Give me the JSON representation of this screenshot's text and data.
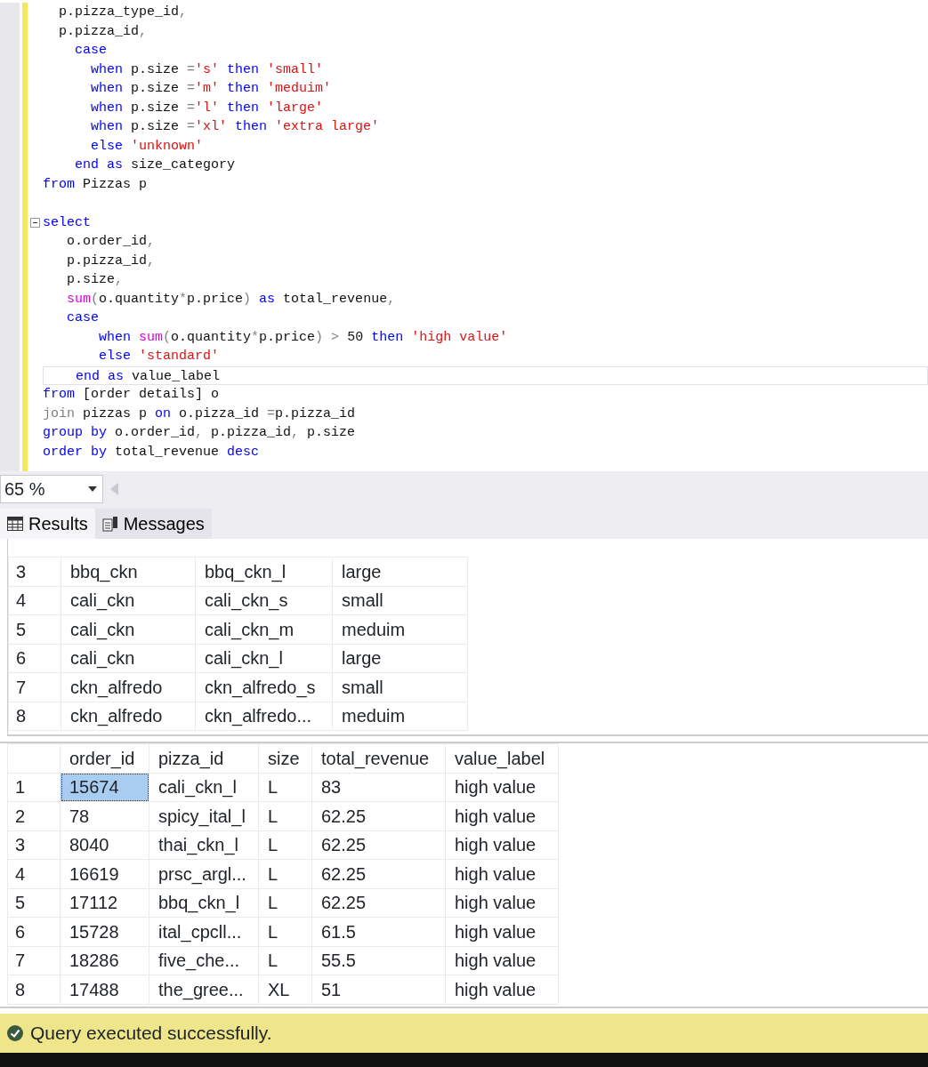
{
  "editor": {
    "lines": [
      {
        "current": false,
        "fold": false,
        "tokens": [
          {
            "kind": "id",
            "text": "  p.pizza_type_id"
          },
          {
            "kind": "op",
            "text": ","
          }
        ]
      },
      {
        "current": false,
        "fold": false,
        "tokens": [
          {
            "kind": "id",
            "text": "  p.pizza_id"
          },
          {
            "kind": "op",
            "text": ","
          }
        ]
      },
      {
        "current": false,
        "fold": false,
        "tokens": [
          {
            "kind": "kw",
            "text": "    case"
          }
        ]
      },
      {
        "current": false,
        "fold": false,
        "tokens": [
          {
            "kind": "kw",
            "text": "      when"
          },
          {
            "kind": "id",
            "text": " p.size "
          },
          {
            "kind": "op",
            "text": "="
          },
          {
            "kind": "str",
            "text": "'s'"
          },
          {
            "kind": "kw",
            "text": " then "
          },
          {
            "kind": "str",
            "text": "'small'"
          }
        ]
      },
      {
        "current": false,
        "fold": false,
        "tokens": [
          {
            "kind": "kw",
            "text": "      when"
          },
          {
            "kind": "id",
            "text": " p.size "
          },
          {
            "kind": "op",
            "text": "="
          },
          {
            "kind": "str",
            "text": "'m'"
          },
          {
            "kind": "kw",
            "text": " then "
          },
          {
            "kind": "str",
            "text": "'meduim'"
          }
        ]
      },
      {
        "current": false,
        "fold": false,
        "tokens": [
          {
            "kind": "kw",
            "text": "      when"
          },
          {
            "kind": "id",
            "text": " p.size "
          },
          {
            "kind": "op",
            "text": "="
          },
          {
            "kind": "str",
            "text": "'l'"
          },
          {
            "kind": "kw",
            "text": " then "
          },
          {
            "kind": "str",
            "text": "'large'"
          }
        ]
      },
      {
        "current": false,
        "fold": false,
        "tokens": [
          {
            "kind": "kw",
            "text": "      when"
          },
          {
            "kind": "id",
            "text": " p.size "
          },
          {
            "kind": "op",
            "text": "="
          },
          {
            "kind": "str",
            "text": "'xl'"
          },
          {
            "kind": "kw",
            "text": " then "
          },
          {
            "kind": "str",
            "text": "'extra large'"
          }
        ]
      },
      {
        "current": false,
        "fold": false,
        "tokens": [
          {
            "kind": "kw",
            "text": "      else "
          },
          {
            "kind": "str",
            "text": "'unknown'"
          }
        ]
      },
      {
        "current": false,
        "fold": false,
        "tokens": [
          {
            "kind": "kw",
            "text": "    end as"
          },
          {
            "kind": "id",
            "text": " size_category"
          }
        ]
      },
      {
        "current": false,
        "fold": false,
        "tokens": [
          {
            "kind": "kw",
            "text": "from"
          },
          {
            "kind": "id",
            "text": " Pizzas p"
          }
        ]
      },
      {
        "current": false,
        "fold": false
      },
      {
        "current": false,
        "fold": true,
        "tokens": [
          {
            "kind": "kw",
            "text": "select"
          }
        ]
      },
      {
        "current": false,
        "fold": false,
        "tokens": [
          {
            "kind": "id",
            "text": "   o.order_id"
          },
          {
            "kind": "op",
            "text": ","
          }
        ]
      },
      {
        "current": false,
        "fold": false,
        "tokens": [
          {
            "kind": "id",
            "text": "   p.pizza_id"
          },
          {
            "kind": "op",
            "text": ","
          }
        ]
      },
      {
        "current": false,
        "fold": false,
        "tokens": [
          {
            "kind": "id",
            "text": "   p.size"
          },
          {
            "kind": "op",
            "text": ","
          }
        ]
      },
      {
        "current": false,
        "fold": false,
        "tokens": [
          {
            "kind": "fn",
            "text": "   sum"
          },
          {
            "kind": "op",
            "text": "("
          },
          {
            "kind": "id",
            "text": "o.quantity"
          },
          {
            "kind": "op",
            "text": "*"
          },
          {
            "kind": "id",
            "text": "p.price"
          },
          {
            "kind": "op",
            "text": ")"
          },
          {
            "kind": "kw",
            "text": " as"
          },
          {
            "kind": "id",
            "text": " total_revenue"
          },
          {
            "kind": "op",
            "text": ","
          }
        ]
      },
      {
        "current": false,
        "fold": false,
        "tokens": [
          {
            "kind": "kw",
            "text": "   case"
          }
        ]
      },
      {
        "current": false,
        "fold": false,
        "tokens": [
          {
            "kind": "kw",
            "text": "       when "
          },
          {
            "kind": "fn",
            "text": "sum"
          },
          {
            "kind": "op",
            "text": "("
          },
          {
            "kind": "id",
            "text": "o.quantity"
          },
          {
            "kind": "op",
            "text": "*"
          },
          {
            "kind": "id",
            "text": "p.price"
          },
          {
            "kind": "op",
            "text": ") >"
          },
          {
            "kind": "id",
            "text": " 50 "
          },
          {
            "kind": "kw",
            "text": "then "
          },
          {
            "kind": "str",
            "text": "'high value'"
          }
        ]
      },
      {
        "current": false,
        "fold": false,
        "tokens": [
          {
            "kind": "kw",
            "text": "       else "
          },
          {
            "kind": "str",
            "text": "'standard'"
          }
        ]
      },
      {
        "current": true,
        "fold": false,
        "tokens": [
          {
            "kind": "kw",
            "text": "    end as"
          },
          {
            "kind": "id",
            "text": " value_label"
          }
        ]
      },
      {
        "current": false,
        "fold": false,
        "tokens": [
          {
            "kind": "kw",
            "text": "from"
          },
          {
            "kind": "id",
            "text": " [order details] o"
          }
        ]
      },
      {
        "current": false,
        "fold": false,
        "tokens": [
          {
            "kind": "op",
            "text": "join"
          },
          {
            "kind": "id",
            "text": " pizzas p "
          },
          {
            "kind": "kw",
            "text": "on"
          },
          {
            "kind": "id",
            "text": " o.pizza_id "
          },
          {
            "kind": "op",
            "text": "="
          },
          {
            "kind": "id",
            "text": "p.pizza_id"
          }
        ]
      },
      {
        "current": false,
        "fold": false,
        "tokens": [
          {
            "kind": "kw",
            "text": "group by"
          },
          {
            "kind": "id",
            "text": " o.order_id"
          },
          {
            "kind": "op",
            "text": ","
          },
          {
            "kind": "id",
            "text": " p.pizza_id"
          },
          {
            "kind": "op",
            "text": ","
          },
          {
            "kind": "id",
            "text": " p.size"
          }
        ]
      },
      {
        "current": false,
        "fold": false,
        "tokens": [
          {
            "kind": "kw",
            "text": "order by"
          },
          {
            "kind": "id",
            "text": " total_revenue "
          },
          {
            "kind": "kw",
            "text": "desc"
          }
        ]
      }
    ]
  },
  "zoom": {
    "value": "65 %"
  },
  "tabs": [
    {
      "label": "Results",
      "selected": true
    },
    {
      "label": "Messages",
      "selected": false
    }
  ],
  "grids": [
    {
      "rows": [
        {
          "number": "3",
          "selected": false,
          "cells": [
            "bbq_ckn",
            "bbq_ckn_l",
            "large"
          ]
        },
        {
          "number": "4",
          "selected": false,
          "cells": [
            "cali_ckn",
            "cali_ckn_s",
            "small"
          ]
        },
        {
          "number": "5",
          "selected": false,
          "cells": [
            "cali_ckn",
            "cali_ckn_m",
            "meduim"
          ]
        },
        {
          "number": "6",
          "selected": false,
          "cells": [
            "cali_ckn",
            "cali_ckn_l",
            "large"
          ]
        },
        {
          "number": "7",
          "selected": false,
          "cells": [
            "ckn_alfredo",
            "ckn_alfredo_s",
            "small"
          ]
        },
        {
          "number": "8",
          "selected": false,
          "cells": [
            "ckn_alfredo",
            "ckn_alfredo...",
            "meduim"
          ]
        }
      ]
    },
    {
      "columns": [
        "order_id",
        "pizza_id",
        "size",
        "total_revenue",
        "value_label"
      ],
      "rows": [
        {
          "number": "1",
          "selected": true,
          "cells": [
            "15674",
            "cali_ckn_l",
            "L",
            "83",
            "high value"
          ]
        },
        {
          "number": "2",
          "selected": false,
          "cells": [
            "78",
            "spicy_ital_l",
            "L",
            "62.25",
            "high value"
          ]
        },
        {
          "number": "3",
          "selected": false,
          "cells": [
            "8040",
            "thai_ckn_l",
            "L",
            "62.25",
            "high value"
          ]
        },
        {
          "number": "4",
          "selected": false,
          "cells": [
            "16619",
            "prsc_argl...",
            "L",
            "62.25",
            "high value"
          ]
        },
        {
          "number": "5",
          "selected": false,
          "cells": [
            "17112",
            "bbq_ckn_l",
            "L",
            "62.25",
            "high value"
          ]
        },
        {
          "number": "6",
          "selected": false,
          "cells": [
            "15728",
            "ital_cpcll...",
            "L",
            "61.5",
            "high value"
          ]
        },
        {
          "number": "7",
          "selected": false,
          "cells": [
            "18286",
            "five_che...",
            "L",
            "55.5",
            "high value"
          ]
        },
        {
          "number": "8",
          "selected": false,
          "cells": [
            "17488",
            "the_gree...",
            "XL",
            "51",
            "high value"
          ]
        }
      ]
    }
  ],
  "status": {
    "text": "Query executed successfully."
  }
}
